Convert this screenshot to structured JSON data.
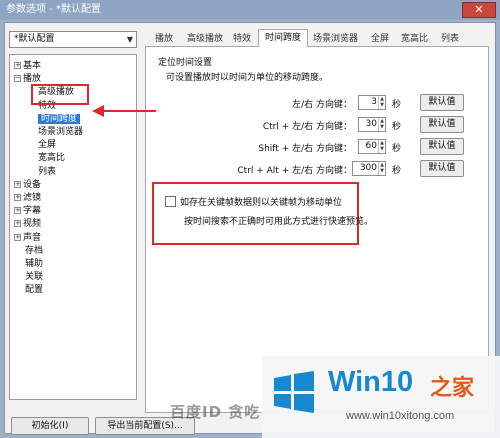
{
  "window": {
    "title": "参数选项 - *默认配置",
    "close_label": "✕"
  },
  "profile_select": {
    "value": "*默认配置"
  },
  "tree": {
    "items": [
      {
        "label": "基本",
        "expander": "+",
        "level": 0
      },
      {
        "label": "播放",
        "expander": "−",
        "level": 0
      },
      {
        "label": "高级播放",
        "level": 1
      },
      {
        "label": "特效",
        "level": 1
      },
      {
        "label": "时间跨度",
        "level": 1,
        "selected": true
      },
      {
        "label": "场景浏览器",
        "level": 1
      },
      {
        "label": "全屏",
        "level": 1
      },
      {
        "label": "宽高比",
        "level": 1
      },
      {
        "label": "列表",
        "level": 1
      },
      {
        "label": "设备",
        "expander": "+",
        "level": 0
      },
      {
        "label": "滤镜",
        "expander": "+",
        "level": 0
      },
      {
        "label": "字幕",
        "expander": "+",
        "level": 0
      },
      {
        "label": "视频",
        "expander": "+",
        "level": 0
      },
      {
        "label": "声音",
        "expander": "+",
        "level": 0
      },
      {
        "label": "存档",
        "level": 0
      },
      {
        "label": "辅助",
        "level": 0
      },
      {
        "label": "关联",
        "level": 0
      },
      {
        "label": "配置",
        "level": 0
      }
    ]
  },
  "tabs": [
    "播放",
    "高级播放",
    "特效",
    "时间跨度",
    "场景浏览器",
    "全屏",
    "宽高比",
    "列表"
  ],
  "active_tab": "时间跨度",
  "panel": {
    "group_title": "定位时间设置",
    "description": "可设置播放时以时间为单位的移动跨度。",
    "rows": [
      {
        "label": "左/右 方向键：",
        "value": "3",
        "unit": "秒",
        "button": "默认值"
      },
      {
        "label": "Ctrl + 左/右 方向键：",
        "value": "30",
        "unit": "秒",
        "button": "默认值"
      },
      {
        "label": "Shift + 左/右 方向键：",
        "value": "60",
        "unit": "秒",
        "button": "默认值"
      },
      {
        "label": "Ctrl + Alt + 左/右 方向键：",
        "value": "300",
        "unit": "秒",
        "button": "默认值"
      }
    ],
    "keyframe_checkbox_label": "如存在关键帧数据则以关键帧为移动单位",
    "keyframe_note": "按时间搜索不正确时可用此方式进行快速预览。"
  },
  "bottom_buttons": {
    "init": "初始化(I)",
    "export": "导出当前配置(S)..."
  },
  "watermarks": {
    "baidu": "百度ID 贪吃",
    "brand": "Win10",
    "brand_suffix": "之家",
    "url": "www.win10xitong.com"
  },
  "colors": {
    "selection": "#2f79d6",
    "annotation_red": "#e2262c",
    "brand_blue": "#1689d0",
    "brand_orange": "#e25a18"
  }
}
